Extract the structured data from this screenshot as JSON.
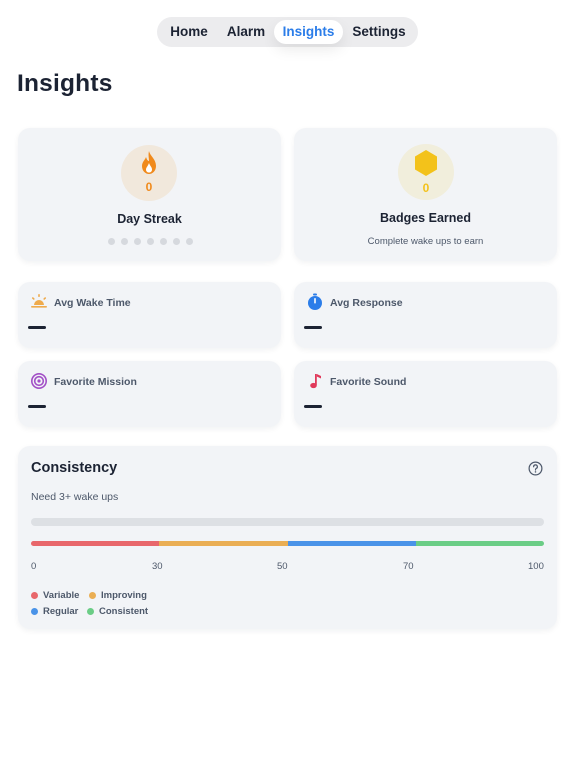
{
  "nav": {
    "tabs": [
      {
        "label": "Home"
      },
      {
        "label": "Alarm"
      },
      {
        "label": "Insights",
        "active": true
      },
      {
        "label": "Settings"
      }
    ]
  },
  "page": {
    "title": "Insights"
  },
  "streak": {
    "value": "0",
    "label": "Day Streak",
    "dot_count": 7,
    "icon": "flame-icon"
  },
  "badges": {
    "value": "0",
    "label": "Badges Earned",
    "subtitle": "Complete wake ups to earn",
    "icon": "hexagon-icon"
  },
  "stats": [
    {
      "label": "Avg Wake Time",
      "icon": "sunrise-icon"
    },
    {
      "label": "Avg Response",
      "icon": "stopwatch-icon"
    },
    {
      "label": "Favorite Mission",
      "icon": "target-icon"
    },
    {
      "label": "Favorite Sound",
      "icon": "music-note-icon"
    }
  ],
  "consistency": {
    "title": "Consistency",
    "subtitle": "Need 3+ wake ups",
    "scale_ticks": [
      "0",
      "30",
      "50",
      "70",
      "100"
    ],
    "legend": [
      {
        "label": "Variable",
        "color": "#e8676b"
      },
      {
        "label": "Improving",
        "color": "#eaae54"
      },
      {
        "label": "Regular",
        "color": "#4a93e8"
      },
      {
        "label": "Consistent",
        "color": "#6bcd86"
      }
    ]
  },
  "colors": {
    "accent": "#2b7de9",
    "streak": "#f08a1c",
    "badge": "#f3c21a",
    "variable": "#e8676b",
    "improving": "#eaae54",
    "regular": "#4a93e8",
    "consistent": "#6bcd86"
  }
}
